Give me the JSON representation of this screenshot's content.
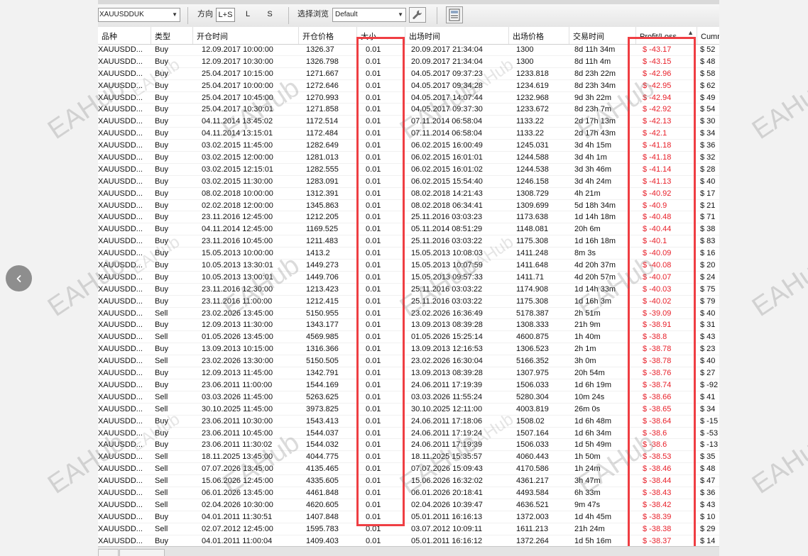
{
  "toolbar": {
    "symbol": "XAUUSDDUK",
    "direction_label": "方向",
    "direction_options": [
      "L+S",
      "L",
      "S"
    ],
    "view_label": "选择浏览",
    "view_value": "Default"
  },
  "columns": [
    "品种",
    "类型",
    "开仓时间",
    "开仓价格",
    "大小",
    "出场时间",
    "出场价格",
    "交易时间",
    "Profit/Loss",
    "Cumm"
  ],
  "rows": [
    [
      "XAUUSDD...",
      "Buy",
      "12.09.2017 10:00:00",
      "1326.37",
      "0.01",
      "20.09.2017 21:34:04",
      "1300",
      "8d 11h 34m",
      "$ -43.17",
      "$ 52"
    ],
    [
      "XAUUSDD...",
      "Buy",
      "12.09.2017 10:30:00",
      "1326.798",
      "0.01",
      "20.09.2017 21:34:04",
      "1300",
      "8d 11h 4m",
      "$ -43.15",
      "$ 48"
    ],
    [
      "XAUUSDD...",
      "Buy",
      "25.04.2017 10:15:00",
      "1271.667",
      "0.01",
      "04.05.2017 09:37:23",
      "1233.818",
      "8d 23h 22m",
      "$ -42.96",
      "$ 58"
    ],
    [
      "XAUUSDD...",
      "Buy",
      "25.04.2017 10:00:00",
      "1272.646",
      "0.01",
      "04.05.2017 09:34:28",
      "1234.619",
      "8d 23h 34m",
      "$ -42.95",
      "$ 62"
    ],
    [
      "XAUUSDD...",
      "Buy",
      "25.04.2017 10:45:00",
      "1270.993",
      "0.01",
      "04.05.2017 14:07:44",
      "1232.968",
      "9d 3h 22m",
      "$ -42.94",
      "$ 49"
    ],
    [
      "XAUUSDD...",
      "Buy",
      "25.04.2017 10:30:01",
      "1271.858",
      "0.01",
      "04.05.2017 09:37:30",
      "1233.672",
      "8d 23h 7m",
      "$ -42.92",
      "$ 54"
    ],
    [
      "XAUUSDD...",
      "Buy",
      "04.11.2014 13:45:02",
      "1172.514",
      "0.01",
      "07.11.2014 06:58:04",
      "1133.22",
      "2d 17h 13m",
      "$ -42.13",
      "$ 30"
    ],
    [
      "XAUUSDD...",
      "Buy",
      "04.11.2014 13:15:01",
      "1172.484",
      "0.01",
      "07.11.2014 06:58:04",
      "1133.22",
      "2d 17h 43m",
      "$ -42.1",
      "$ 34"
    ],
    [
      "XAUUSDD...",
      "Buy",
      "03.02.2015 11:45:00",
      "1282.649",
      "0.01",
      "06.02.2015 16:00:49",
      "1245.031",
      "3d 4h 15m",
      "$ -41.18",
      "$ 36"
    ],
    [
      "XAUUSDD...",
      "Buy",
      "03.02.2015 12:00:00",
      "1281.013",
      "0.01",
      "06.02.2015 16:01:01",
      "1244.588",
      "3d 4h 1m",
      "$ -41.18",
      "$ 32"
    ],
    [
      "XAUUSDD...",
      "Buy",
      "03.02.2015 12:15:01",
      "1282.555",
      "0.01",
      "06.02.2015 16:01:02",
      "1244.538",
      "3d 3h 46m",
      "$ -41.14",
      "$ 28"
    ],
    [
      "XAUUSDD...",
      "Buy",
      "03.02.2015 11:30:00",
      "1283.091",
      "0.01",
      "06.02.2015 15:54:40",
      "1246.158",
      "3d 4h 24m",
      "$ -41.13",
      "$ 40"
    ],
    [
      "XAUUSDD...",
      "Buy",
      "08.02.2018 10:00:00",
      "1312.391",
      "0.01",
      "08.02.2018 14:21:43",
      "1308.729",
      "4h 21m",
      "$ -40.92",
      "$ 17"
    ],
    [
      "XAUUSDD...",
      "Buy",
      "02.02.2018 12:00:00",
      "1345.863",
      "0.01",
      "08.02.2018 06:34:41",
      "1309.699",
      "5d 18h 34m",
      "$ -40.9",
      "$ 21"
    ],
    [
      "XAUUSDD...",
      "Buy",
      "23.11.2016 12:45:00",
      "1212.205",
      "0.01",
      "25.11.2016 03:03:23",
      "1173.638",
      "1d 14h 18m",
      "$ -40.48",
      "$ 71"
    ],
    [
      "XAUUSDD...",
      "Buy",
      "04.11.2014 12:45:00",
      "1169.525",
      "0.01",
      "05.11.2014 08:51:29",
      "1148.081",
      "20h 6m",
      "$ -40.44",
      "$ 38"
    ],
    [
      "XAUUSDD...",
      "Buy",
      "23.11.2016 10:45:00",
      "1211.483",
      "0.01",
      "25.11.2016 03:03:22",
      "1175.308",
      "1d 16h 18m",
      "$ -40.1",
      "$ 83"
    ],
    [
      "XAUUSDD...",
      "Buy",
      "15.05.2013 10:00:00",
      "1413.2",
      "0.01",
      "15.05.2013 10:08:03",
      "1411.248",
      "8m 3s",
      "$ -40.09",
      "$ 16"
    ],
    [
      "XAUUSDD...",
      "Buy",
      "10.05.2013 13:30:01",
      "1449.273",
      "0.01",
      "15.05.2013 10:07:59",
      "1411.648",
      "4d 20h 37m",
      "$ -40.08",
      "$ 20"
    ],
    [
      "XAUUSDD...",
      "Buy",
      "10.05.2013 13:00:01",
      "1449.706",
      "0.01",
      "15.05.2013 09:57:33",
      "1411.71",
      "4d 20h 57m",
      "$ -40.07",
      "$ 24"
    ],
    [
      "XAUUSDD...",
      "Buy",
      "23.11.2016 12:30:00",
      "1213.423",
      "0.01",
      "25.11.2016 03:03:22",
      "1174.908",
      "1d 14h 33m",
      "$ -40.03",
      "$ 75"
    ],
    [
      "XAUUSDD...",
      "Buy",
      "23.11.2016 11:00:00",
      "1212.415",
      "0.01",
      "25.11.2016 03:03:22",
      "1175.308",
      "1d 16h 3m",
      "$ -40.02",
      "$ 79"
    ],
    [
      "XAUUSDD...",
      "Sell",
      "23.02.2026 13:45:00",
      "5150.955",
      "0.01",
      "23.02.2026 16:36:49",
      "5178.387",
      "2h 51m",
      "$ -39.09",
      "$ 40"
    ],
    [
      "XAUUSDD...",
      "Buy",
      "12.09.2013 11:30:00",
      "1343.177",
      "0.01",
      "13.09.2013 08:39:28",
      "1308.333",
      "21h 9m",
      "$ -38.91",
      "$ 31"
    ],
    [
      "XAUUSDD...",
      "Sell",
      "01.05.2026 13:45:00",
      "4569.985",
      "0.01",
      "01.05.2026 15:25:14",
      "4600.875",
      "1h 40m",
      "$ -38.8",
      "$ 43"
    ],
    [
      "XAUUSDD...",
      "Buy",
      "13.09.2013 10:15:00",
      "1316.366",
      "0.01",
      "13.09.2013 12:16:53",
      "1306.523",
      "2h 1m",
      "$ -38.78",
      "$ 23"
    ],
    [
      "XAUUSDD...",
      "Sell",
      "23.02.2026 13:30:00",
      "5150.505",
      "0.01",
      "23.02.2026 16:30:04",
      "5166.352",
      "3h 0m",
      "$ -38.78",
      "$ 40"
    ],
    [
      "XAUUSDD...",
      "Buy",
      "12.09.2013 11:45:00",
      "1342.791",
      "0.01",
      "13.09.2013 08:39:28",
      "1307.975",
      "20h 54m",
      "$ -38.76",
      "$ 27"
    ],
    [
      "XAUUSDD...",
      "Buy",
      "23.06.2011 11:00:00",
      "1544.169",
      "0.01",
      "24.06.2011 17:19:39",
      "1506.033",
      "1d 6h 19m",
      "$ -38.74",
      "$ -92"
    ],
    [
      "XAUUSDD...",
      "Sell",
      "03.03.2026 11:45:00",
      "5263.625",
      "0.01",
      "03.03.2026 11:55:24",
      "5280.304",
      "10m 24s",
      "$ -38.66",
      "$ 41"
    ],
    [
      "XAUUSDD...",
      "Sell",
      "30.10.2025 11:45:00",
      "3973.825",
      "0.01",
      "30.10.2025 12:11:00",
      "4003.819",
      "26m 0s",
      "$ -38.65",
      "$ 34"
    ],
    [
      "XAUUSDD...",
      "Buy",
      "23.06.2011 10:30:00",
      "1543.413",
      "0.01",
      "24.06.2011 17:18:06",
      "1508.02",
      "1d 6h 48m",
      "$ -38.64",
      "$ -15"
    ],
    [
      "XAUUSDD...",
      "Buy",
      "23.06.2011 10:45:00",
      "1544.037",
      "0.01",
      "24.06.2011 17:19:24",
      "1507.164",
      "1d 6h 34m",
      "$ -38.6",
      "$ -53"
    ],
    [
      "XAUUSDD...",
      "Buy",
      "23.06.2011 11:30:02",
      "1544.032",
      "0.01",
      "24.06.2011 17:19:39",
      "1506.033",
      "1d 5h 49m",
      "$ -38.6",
      "$ -13"
    ],
    [
      "XAUUSDD...",
      "Sell",
      "18.11.2025 13:45:00",
      "4044.775",
      "0.01",
      "18.11.2025 15:35:57",
      "4060.443",
      "1h 50m",
      "$ -38.53",
      "$ 35"
    ],
    [
      "XAUUSDD...",
      "Sell",
      "07.07.2026 13:45:00",
      "4135.465",
      "0.01",
      "07.07.2026 15:09:43",
      "4170.586",
      "1h 24m",
      "$ -38.46",
      "$ 48"
    ],
    [
      "XAUUSDD...",
      "Sell",
      "15.06.2026 12:45:00",
      "4335.605",
      "0.01",
      "15.06.2026 16:32:02",
      "4361.217",
      "3h 47m",
      "$ -38.44",
      "$ 47"
    ],
    [
      "XAUUSDD...",
      "Sell",
      "06.01.2026 13:45:00",
      "4461.848",
      "0.01",
      "06.01.2026 20:18:41",
      "4493.584",
      "6h 33m",
      "$ -38.43",
      "$ 36"
    ],
    [
      "XAUUSDD...",
      "Sell",
      "02.04.2026 10:30:00",
      "4620.605",
      "0.01",
      "02.04.2026 10:39:47",
      "4636.521",
      "9m 47s",
      "$ -38.42",
      "$ 43"
    ],
    [
      "XAUUSDD...",
      "Buy",
      "04.01.2011 11:30:51",
      "1407.848",
      "0.01",
      "05.01.2011 16:16:13",
      "1372.003",
      "1d 4h 45m",
      "$ -38.39",
      "$ 10"
    ],
    [
      "XAUUSDD...",
      "Sell",
      "02.07.2012 12:45:00",
      "1595.783",
      "0.01",
      "03.07.2012 10:09:11",
      "1611.213",
      "21h 24m",
      "$ -38.38",
      "$ 29"
    ],
    [
      "XAUUSDD...",
      "Buy",
      "04.01.2011 11:00:04",
      "1409.403",
      "0.01",
      "05.01.2011 16:16:12",
      "1372.264",
      "1d 5h 16m",
      "$ -38.37",
      "$ 14"
    ]
  ],
  "watermark": "EAHub",
  "accent": "#ef3e43",
  "loss_color": "#e8202a"
}
